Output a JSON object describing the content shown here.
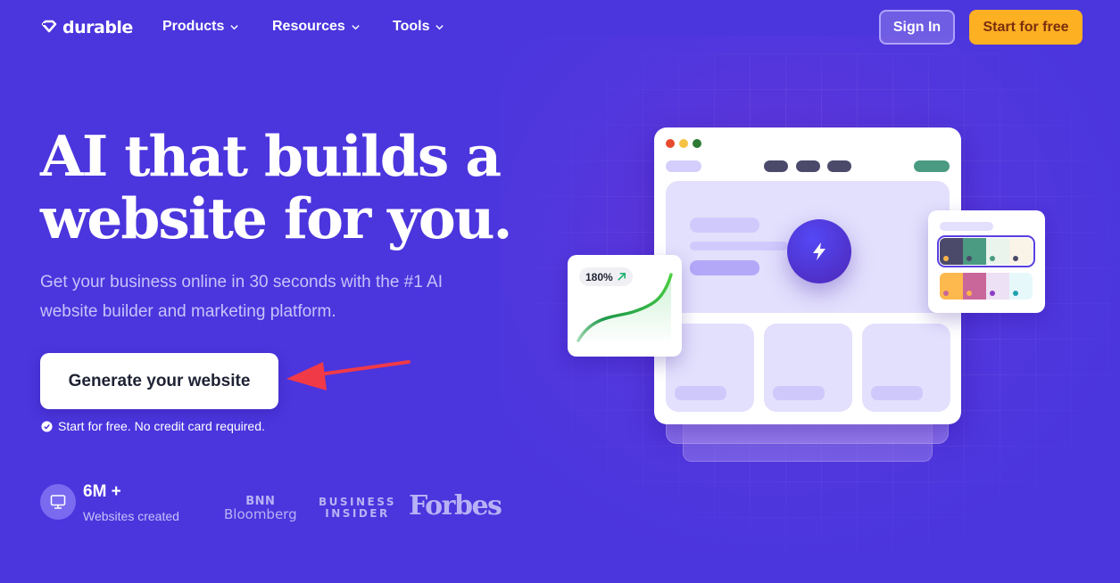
{
  "nav": {
    "logo_text": "durable",
    "items": [
      {
        "label": "Products"
      },
      {
        "label": "Resources"
      },
      {
        "label": "Tools"
      }
    ],
    "sign_in_label": "Sign In",
    "start_label": "Start for free"
  },
  "hero": {
    "title_line1": "AI that builds a",
    "title_line2": "website for you.",
    "subtitle": "Get your business online in 30 seconds with the #1 AI website builder and marketing platform.",
    "cta_label": "Generate your website",
    "note": "Start for free. No credit card required."
  },
  "stats": {
    "value": "6M +",
    "label": "Websites created"
  },
  "press": {
    "bnn_line1": "BNN",
    "bnn_line2": "Bloomberg",
    "bi_line1": "BUSINESS",
    "bi_line2": "INSIDER",
    "forbes": "Forbes"
  },
  "illustration": {
    "growth_badge": "180%",
    "palettes": [
      {
        "selected": true,
        "colors": [
          "#4b4a6b",
          "#4b9a82",
          "#eaf4ec",
          "#faf3e8"
        ],
        "dots": [
          "#fdb54a",
          "#4b4a6b",
          "#4b9a82",
          "#4b4a6b"
        ]
      },
      {
        "selected": false,
        "colors": [
          "#fdb94e",
          "#c9679a",
          "#ede1f5",
          "#e7f8fb"
        ],
        "dots": [
          "#c9679a",
          "#fdb54a",
          "#8e3cc4",
          "#1ea2b0"
        ]
      }
    ]
  },
  "colors": {
    "background": "#4b35dd",
    "accent_yellow": "#fdb022",
    "annotation_arrow": "#f03a47"
  }
}
